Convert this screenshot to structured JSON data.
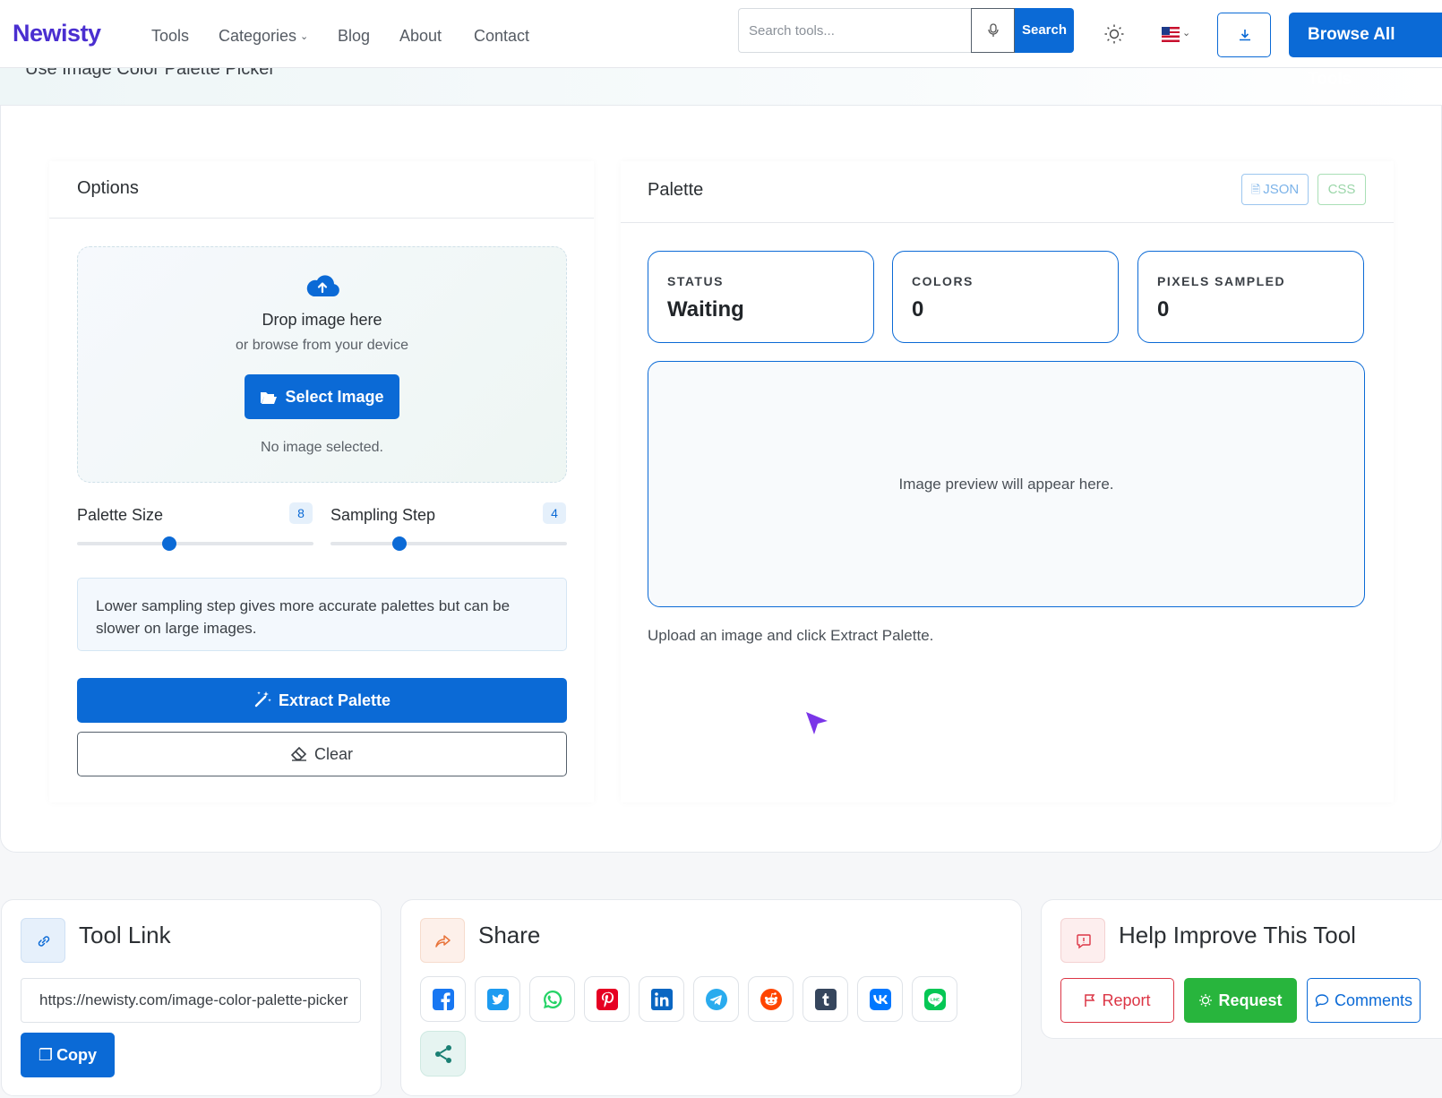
{
  "nav": {
    "brand": "Newisty",
    "links": [
      "Tools",
      "Categories",
      "Blog",
      "About",
      "Contact"
    ],
    "search_placeholder": "Search tools...",
    "search_label": "Search",
    "browse_label": "Browse All Tools"
  },
  "hero": {
    "title": "Use Image Color Palette Picker"
  },
  "options": {
    "title": "Options",
    "drop_title": "Drop image here",
    "drop_sub": "or browse from your device",
    "select_label": "Select Image",
    "no_image": "No image selected.",
    "palette_size_label": "Palette Size",
    "palette_size_value": "8",
    "palette_size_fraction": 0.39,
    "sampling_label": "Sampling Step",
    "sampling_value": "4",
    "sampling_fraction": 0.29,
    "note": "Lower sampling step gives more accurate palettes but can be slower on large images.",
    "extract_label": "Extract Palette",
    "clear_label": "Clear"
  },
  "palette": {
    "title": "Palette",
    "json_label": "JSON",
    "css_label": "CSS",
    "stats": [
      {
        "label": "STATUS",
        "value": "Waiting"
      },
      {
        "label": "COLORS",
        "value": "0"
      },
      {
        "label": "PIXELS SAMPLED",
        "value": "0"
      }
    ],
    "preview_text": "Image preview will appear here.",
    "hint": "Upload an image and click Extract Palette."
  },
  "tool_link": {
    "title": "Tool Link",
    "url": "https://newisty.com/image-color-palette-picker",
    "copy_label": "Copy"
  },
  "share": {
    "title": "Share",
    "networks": [
      "facebook",
      "twitter",
      "whatsapp",
      "pinterest",
      "linkedin",
      "telegram",
      "reddit",
      "tumblr",
      "vk",
      "line",
      "share"
    ]
  },
  "help": {
    "title": "Help Improve This Tool",
    "report_label": "Report",
    "request_label": "Request",
    "comments_label": "Comments"
  },
  "colors": {
    "primary": "#0b6ad6",
    "brand": "#4a2fd0",
    "success": "#28a745",
    "danger": "#dc3545"
  }
}
